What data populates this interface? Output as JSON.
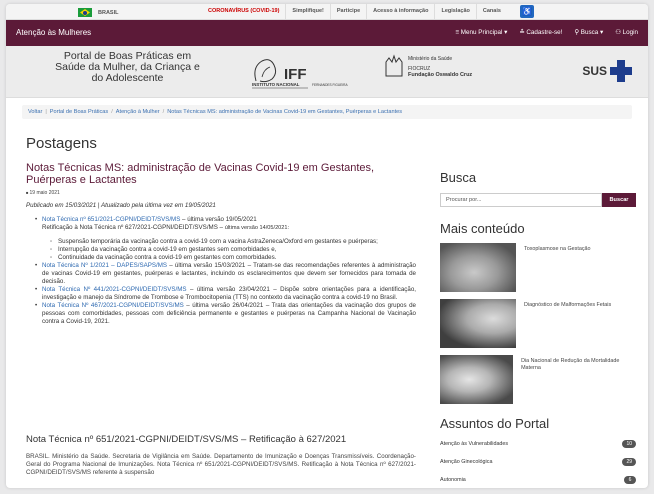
{
  "govbar": {
    "country": "BRASIL",
    "links": [
      "CORONAVÍRUS (COVID-19)",
      "Simplifique!",
      "Participe",
      "Acesso à informação",
      "Legislação",
      "Canais"
    ]
  },
  "sitenav": {
    "site_name": "Atenção às Mulheres",
    "menu_label": "≡ Menu Principal ▾",
    "signup_label": "≛ Cadastre-se!",
    "search_label": "⚲ Busca ▾",
    "login_label": "⚇ Login"
  },
  "banner": {
    "portal_title": "Portal de Boas Práticas em Saúde da Mulher, da Criança e do Adolescente",
    "iff_text": "IFF",
    "iff_sub": "INSTITUTO NACIONAL",
    "iff_sub2": "FERNANDES FIGUEIRA",
    "ministry": "Ministério da Saúde",
    "fiocruz": "FIOCRUZ",
    "fiocruz_name": "Fundação Oswaldo Cruz",
    "sus": "SUS"
  },
  "breadcrumb": {
    "items": [
      "Voltar",
      "Portal de Boas Práticas",
      "Atenção à Mulher",
      "Notas Técnicas MS: administração de Vacinas Covid-19 em Gestantes, Puérperas e Lactantes"
    ]
  },
  "page_heading": "Postagens",
  "article": {
    "title": "Notas Técnicas MS: administração de Vacinas Covid-19 em Gestantes, Puérperas e Lactantes",
    "date": "19 maio 2021",
    "published": "Publicado em 15/03/2021 | Atualizado pela última vez em 19/05/2021",
    "n1_link": "Nota Técnica nº 651/2021-CGPNI/DEIDT/SVS/MS",
    "n1_rest": " – última versão 19/05/2021",
    "n1_line2": "Retificação à Nota Técnica nº 627/2021-CGPNI/DEIDT/SVS/MS – ",
    "n1_line2_small": "última versão 14/05/2021:",
    "subs": [
      "Suspensão temporária da vacinação contra a covid-19 com a vacina AstraZeneca/Oxford em gestantes e puérperas;",
      "Interrupção da vacinação contra a covid-19 em gestantes sem comorbidades e,",
      "Continuidade da vacinação contra a covid-19 em gestantes com comorbidades."
    ],
    "n2_link": "Nota Técnica Nº 1/2021 – DAPES/SAPS/MS",
    "n2_rest": " – última versão 15/03/2021 – Tratam-se das recomendações referentes à administração de vacinas Covid-19 em gestantes, puérperas e lactantes, incluindo os esclarecimentos que devem ser fornecidos para tomada de decisão.",
    "n3_link": "Nota Técnica Nº 441/2021-CGPNI/DEIDT/SVS/MS",
    "n3_rest": " – última versão 23/04/2021 – Dispõe sobre orientações para a identificação, investigação e manejo da Síndrome de Trombose e Trombocitopenia (TTS) no contexto da vacinação contra a covid-19 no Brasil.",
    "n4_link": "Nota Técnica Nº 467/2021-CGPNI/DEIDT/SVS/MS",
    "n4_rest": " – última versão 26/04/2021 – Trata das orientações da vacinação dos grupos de pessoas com comorbidades, pessoas com deficiência permanente e gestantes e puérperas na Campanha Nacional de Vacinação contra a Covid-19, 2021."
  },
  "article2": {
    "title": "Nota Técnica nº 651/2021-CGPNI/DEIDT/SVS/MS – Retificação à 627/2021",
    "text": "BRASIL. Ministério da Saúde. Secretaria de Vigilância em Saúde. Departamento de Imunização e Doenças Transmissíveis. Coordenação-Geral do Programa Nacional de Imunizações. Nota Técnica nº 651/2021-CGPNI/DEIDT/SVS/MS. Retificação à Nota Técnica nº 627/2021-CGPNI/DEIDT/SVS/MS referente à suspensão"
  },
  "sidebar": {
    "search_heading": "Busca",
    "search_placeholder": "Procurar por...",
    "search_button": "Buscar",
    "more_heading": "Mais conteúdo",
    "more_items": [
      "Toxoplasmose na Gestação",
      "Diagnóstico de Malformações Fetais",
      "Dia Nacional de Redução da Mortalidade Materna"
    ],
    "subjects_heading": "Assuntos do Portal",
    "subjects": [
      {
        "label": "Atenção às Vulnerabilidades",
        "count": "10"
      },
      {
        "label": "Atenção Ginecológica",
        "count": "29"
      },
      {
        "label": "Autonomia",
        "count": "6"
      }
    ]
  }
}
